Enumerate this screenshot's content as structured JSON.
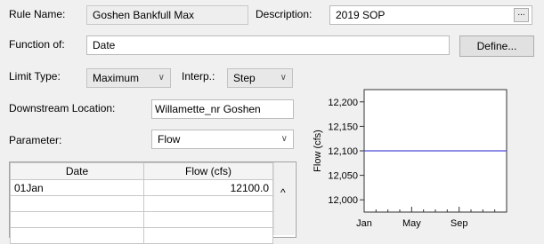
{
  "rule_name": {
    "label": "Rule Name:",
    "value": "Goshen Bankfull Max"
  },
  "description": {
    "label": "Description:",
    "value": "2019 SOP",
    "button_label": "..."
  },
  "function_of": {
    "label": "Function of:",
    "value": "Date",
    "define_label": "Define..."
  },
  "limit_type": {
    "label": "Limit Type:",
    "selected": "Maximum"
  },
  "interp": {
    "label": "Interp.:",
    "selected": "Step"
  },
  "downstream_location": {
    "label": "Downstream Location:",
    "value": "Willamette_nr Goshen"
  },
  "parameter": {
    "label": "Parameter:",
    "selected": "Flow"
  },
  "table": {
    "headers": [
      "Date",
      "Flow (cfs)"
    ],
    "rows": [
      [
        "01Jan",
        "12100.0"
      ],
      [
        "",
        ""
      ],
      [
        "",
        ""
      ],
      [
        "",
        ""
      ]
    ],
    "scroll_up_glyph": "^"
  },
  "chart_data": {
    "type": "line",
    "ylabel": "Flow (cfs)",
    "xlabel": "",
    "ylim": [
      11975,
      12225
    ],
    "ytick_labels": [
      "12,200",
      "12,150",
      "12,100",
      "12,050",
      "12,000"
    ],
    "ytick_values": [
      12200,
      12150,
      12100,
      12050,
      12000
    ],
    "xtick_labels": [
      "Jan",
      "May",
      "Sep"
    ],
    "xtick_months": [
      0,
      4,
      8
    ],
    "x_months": [
      0,
      12
    ],
    "series": [
      {
        "x": [
          "Jan",
          "Dec"
        ],
        "values": [
          12100,
          12100
        ]
      }
    ],
    "line_color": "#4a4ad8",
    "grid": false
  }
}
